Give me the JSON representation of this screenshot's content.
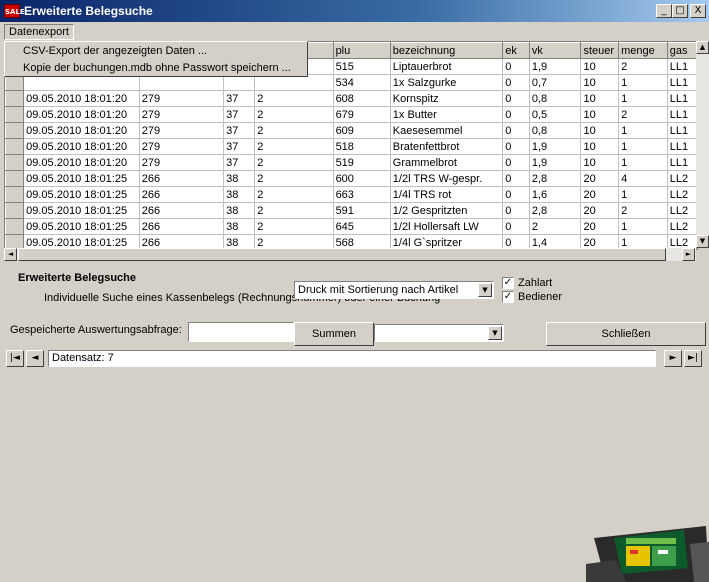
{
  "window": {
    "title": "Erweiterte Belegsuche",
    "icon_text": "SALE",
    "min_glyph": "_",
    "max_glyph": "□",
    "close_glyph": "X"
  },
  "menu": {
    "label": "Datenexport",
    "items": [
      "CSV-Export der angezeigten Daten ...",
      "Kopie der buchungen.mdb ohne Passwort speichern ..."
    ]
  },
  "grid": {
    "columns": [
      "",
      "",
      "",
      "",
      "nummer",
      "plu",
      "bezeichnung",
      "ek",
      "vk",
      "steuer",
      "menge",
      "gas"
    ],
    "rows": [
      [
        "",
        "",
        "",
        "",
        "",
        "515",
        "Liptauerbrot",
        "0",
        "1,9",
        "10",
        "2",
        "LL1"
      ],
      [
        "",
        "",
        "",
        "",
        "",
        "534",
        "1x Salzgurke",
        "0",
        "0,7",
        "10",
        "1",
        "LL1"
      ],
      [
        "",
        "09.05.2010 18:01:20",
        "279",
        "37",
        "2",
        "608",
        "Kornspitz",
        "0",
        "0,8",
        "10",
        "1",
        "LL1"
      ],
      [
        "",
        "09.05.2010 18:01:20",
        "279",
        "37",
        "2",
        "679",
        "1x Butter",
        "0",
        "0,5",
        "10",
        "2",
        "LL1"
      ],
      [
        "",
        "09.05.2010 18:01:20",
        "279",
        "37",
        "2",
        "609",
        "Kaesesemmel",
        "0",
        "0,8",
        "10",
        "1",
        "LL1"
      ],
      [
        "",
        "09.05.2010 18:01:20",
        "279",
        "37",
        "2",
        "518",
        "Bratenfettbrot",
        "0",
        "1,9",
        "10",
        "1",
        "LL1"
      ],
      [
        "",
        "09.05.2010 18:01:20",
        "279",
        "37",
        "2",
        "519",
        "Grammelbrot",
        "0",
        "1,9",
        "10",
        "1",
        "LL1"
      ],
      [
        "",
        "09.05.2010 18:01:25",
        "266",
        "38",
        "2",
        "600",
        "1/2l TRS W-gespr.",
        "0",
        "2,8",
        "20",
        "4",
        "LL2"
      ],
      [
        "",
        "09.05.2010 18:01:25",
        "266",
        "38",
        "2",
        "663",
        "1/4l TRS rot",
        "0",
        "1,6",
        "20",
        "1",
        "LL2"
      ],
      [
        "",
        "09.05.2010 18:01:25",
        "266",
        "38",
        "2",
        "591",
        "1/2 Gespritzten",
        "0",
        "2,8",
        "20",
        "2",
        "LL2"
      ],
      [
        "",
        "09.05.2010 18:01:25",
        "266",
        "38",
        "2",
        "645",
        "1/2l Hollersaft LW",
        "0",
        "2",
        "20",
        "1",
        "LL2"
      ],
      [
        "",
        "09.05.2010 18:01:25",
        "266",
        "38",
        "2",
        "568",
        "1/4l G`spritzer",
        "0",
        "1,4",
        "20",
        "1",
        "LL2"
      ]
    ]
  },
  "panel": {
    "heading": "Erweiterte Belegsuche",
    "description": "Individuelle Suche eines Kassenbelegs (Rechnungsnummer) oder einer Buchung",
    "sort_select": "Druck mit Sortierung nach Artikel",
    "zahlart_label": "Zahlart",
    "bediener_label": "Bediener",
    "check_glyph": "✓",
    "saved_query_label": "Gespeicherte Auswertungsabfrage:",
    "saved_query_value": "",
    "summen_label": "Summen",
    "summen_select": "",
    "close_label": "Schließen"
  },
  "nav": {
    "record_text": "Datensatz: 7"
  }
}
